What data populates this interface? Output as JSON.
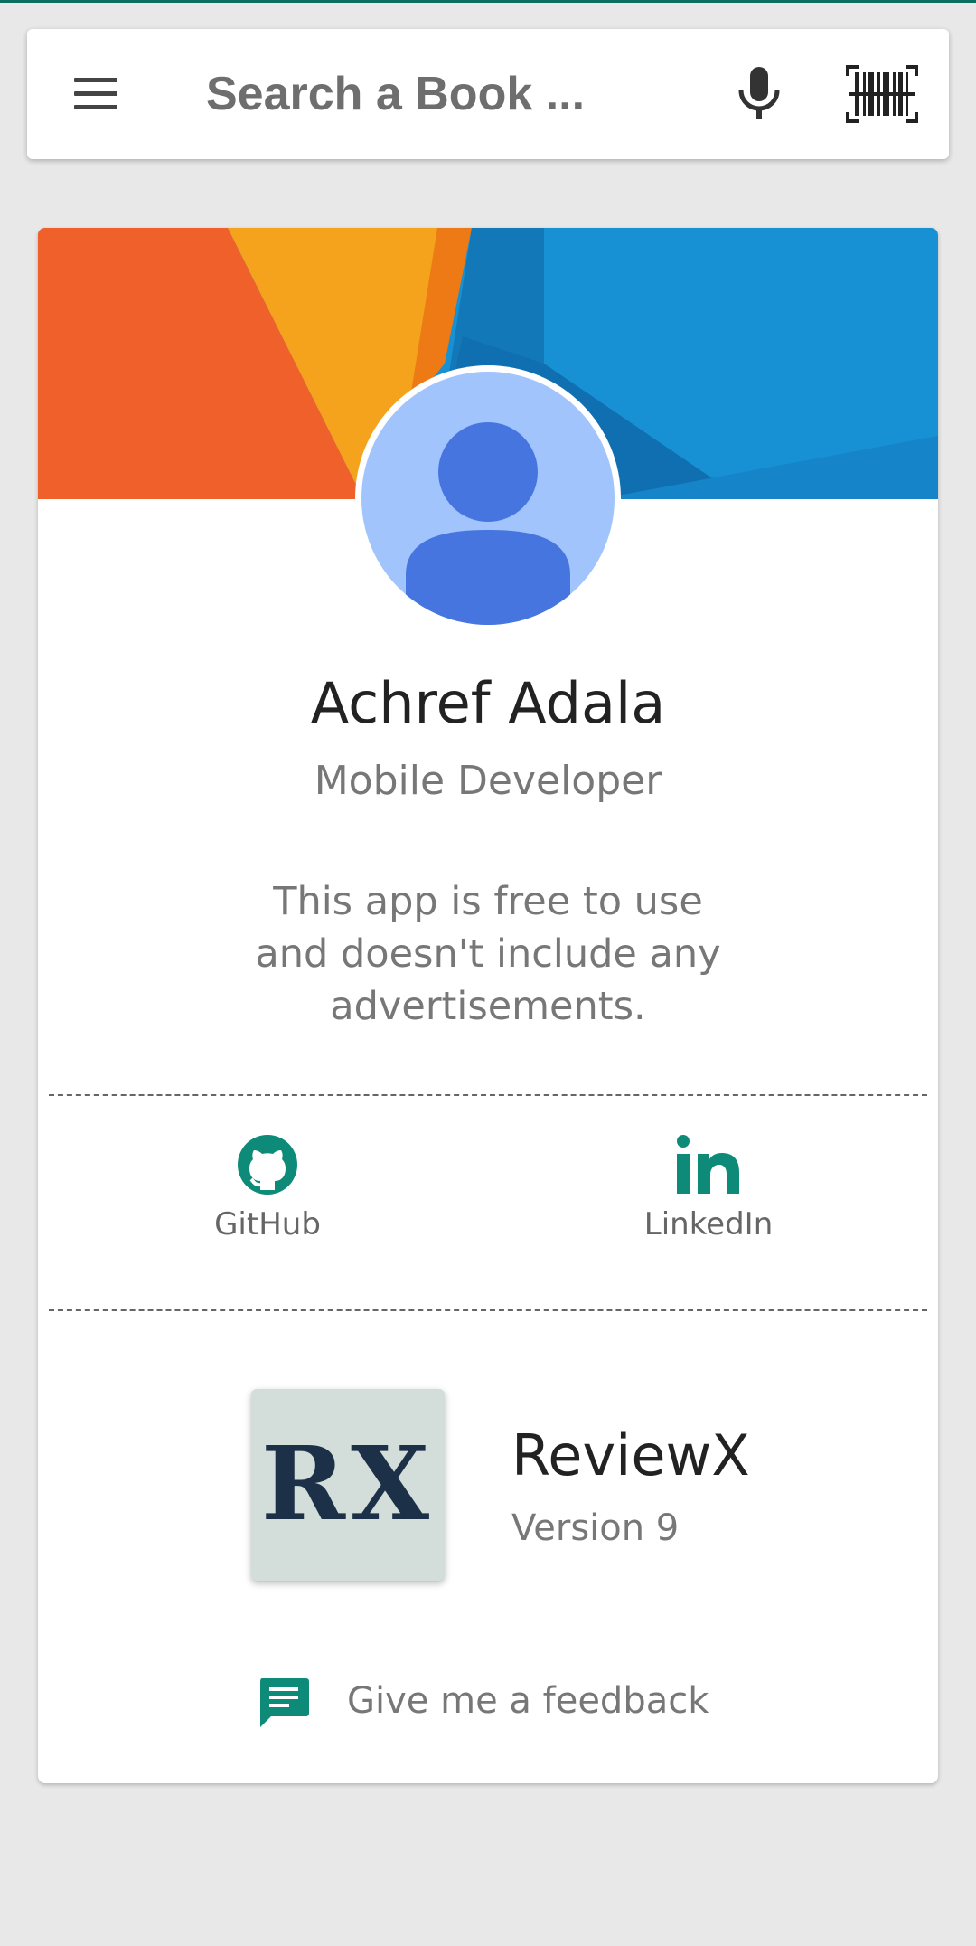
{
  "search": {
    "placeholder": "Search a Book ...",
    "menu_icon": "hamburger-menu-icon",
    "mic_icon": "microphone-icon",
    "barcode_icon": "barcode-scan-icon"
  },
  "profile": {
    "name": "Achref Adala",
    "role": "Mobile Developer",
    "note_lines": [
      "This app is free to use",
      "and doesn't include any",
      "advertisements."
    ],
    "avatar_icon": "person-avatar-icon"
  },
  "links": [
    {
      "label": "GitHub",
      "icon": "github-icon"
    },
    {
      "label": "LinkedIn",
      "icon": "linkedin-icon"
    }
  ],
  "app": {
    "logo_text": "RX",
    "name": "ReviewX",
    "version": "Version 9"
  },
  "feedback": {
    "label": "Give me a feedback",
    "icon": "feedback-chat-icon"
  },
  "colors": {
    "accent": "#0e8a78",
    "banner_orange": "#f0602a",
    "banner_yellow": "#f5a31c",
    "banner_blue": "#1890d4",
    "avatar_light": "#a0c4fb",
    "avatar_dark": "#4675e0"
  }
}
